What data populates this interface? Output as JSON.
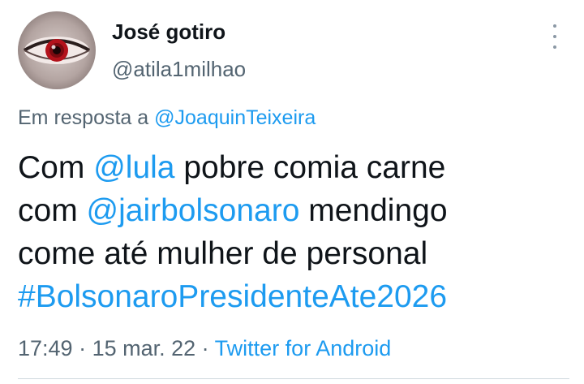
{
  "author": {
    "display_name": "José gotiro",
    "handle": "@atila1milhao",
    "avatar_icon": "red-eye-avatar"
  },
  "more_icon": "more-vertical-icon",
  "reply": {
    "prefix": "Em resposta a",
    "target": "@JoaquinTeixeira"
  },
  "body": {
    "line1_a": "Com ",
    "line1_mention": "@lula",
    "line1_b": " pobre comia carne",
    "line2_a": "com ",
    "line2_mention": "@jairbolsonaro",
    "line2_b": " mendingo",
    "line3": "come até mulher de personal",
    "hashtag": "#BolsonaroPresidenteAte2026"
  },
  "meta": {
    "time": "17:49",
    "separator": " · ",
    "date": "15 mar. 22",
    "source": "Twitter for Android"
  },
  "colors": {
    "link": "#1d9bf0",
    "text": "#0f1419",
    "secondary": "#536471"
  }
}
